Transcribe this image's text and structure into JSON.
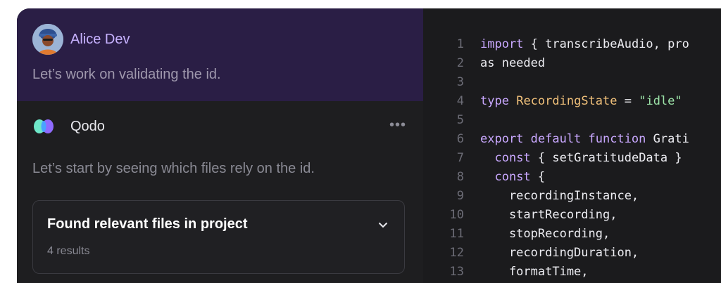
{
  "conversation": {
    "user": {
      "name": "Alice Dev",
      "message": "Let’s work on validating the id."
    },
    "assistant": {
      "name": "Qodo",
      "more_label": "•••",
      "message": "Let’s start by seeing which files rely on the id.",
      "card": {
        "title": "Found relevant files in project",
        "subtitle": "4 results"
      }
    }
  },
  "editor": {
    "lines": [
      {
        "n": "1",
        "segments": [
          {
            "t": "kw",
            "v": "import"
          },
          {
            "t": "pl",
            "v": " { transcribeAudio, pro"
          }
        ]
      },
      {
        "n": "2",
        "segments": [
          {
            "t": "pl",
            "v": "as needed"
          }
        ]
      },
      {
        "n": "3",
        "segments": []
      },
      {
        "n": "4",
        "segments": [
          {
            "t": "kw",
            "v": "type"
          },
          {
            "t": "pl",
            "v": " "
          },
          {
            "t": "ty",
            "v": "RecordingState"
          },
          {
            "t": "pl",
            "v": " = "
          },
          {
            "t": "str",
            "v": "\"idle\""
          }
        ]
      },
      {
        "n": "5",
        "segments": []
      },
      {
        "n": "6",
        "segments": [
          {
            "t": "kw",
            "v": "export default function"
          },
          {
            "t": "pl",
            "v": " Grati"
          }
        ]
      },
      {
        "n": "7",
        "segments": [
          {
            "t": "pl",
            "v": "  "
          },
          {
            "t": "kw",
            "v": "const"
          },
          {
            "t": "pl",
            "v": " { setGratitudeData }"
          }
        ]
      },
      {
        "n": "8",
        "segments": [
          {
            "t": "pl",
            "v": "  "
          },
          {
            "t": "kw",
            "v": "const"
          },
          {
            "t": "pl",
            "v": " {"
          }
        ]
      },
      {
        "n": "9",
        "segments": [
          {
            "t": "pl",
            "v": "    recordingInstance,"
          }
        ]
      },
      {
        "n": "10",
        "segments": [
          {
            "t": "pl",
            "v": "    startRecording,"
          }
        ]
      },
      {
        "n": "11",
        "segments": [
          {
            "t": "pl",
            "v": "    stopRecording,"
          }
        ]
      },
      {
        "n": "12",
        "segments": [
          {
            "t": "pl",
            "v": "    recordingDuration,"
          }
        ]
      },
      {
        "n": "13",
        "segments": [
          {
            "t": "pl",
            "v": "    formatTime,"
          }
        ]
      }
    ]
  },
  "colors": {
    "user_bg": "#2a1e45",
    "user_name": "#c7b2ff",
    "keyword": "#c9a8ff",
    "type": "#f0c07a",
    "string": "#9ce3a8"
  }
}
